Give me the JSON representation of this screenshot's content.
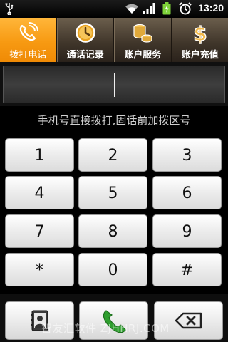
{
  "status_bar": {
    "time": "13:20",
    "icons": [
      "usb-icon",
      "wifi-icon",
      "signal-icon",
      "battery-charging-icon",
      "alarm-icon"
    ]
  },
  "tabs": [
    {
      "label": "拨打电话",
      "icon": "phone-ring-icon",
      "active": true
    },
    {
      "label": "通话记录",
      "icon": "clock-icon",
      "active": false
    },
    {
      "label": "账户服务",
      "icon": "coins-icon",
      "active": false
    },
    {
      "label": "账户充值",
      "icon": "dollar-icon",
      "active": false
    }
  ],
  "number_display": {
    "value": ""
  },
  "hint": "手机号直接拨打,固话前加拨区号",
  "keypad": {
    "keys": [
      "1",
      "2",
      "3",
      "4",
      "5",
      "6",
      "7",
      "8",
      "9",
      "*",
      "0",
      "#"
    ]
  },
  "bottom_bar": {
    "buttons": [
      "contacts-icon",
      "call-icon",
      "backspace-icon"
    ]
  },
  "watermark": "智友汇软件 ZJHHRJ.COM",
  "colors": {
    "tab_active": "#f79a12",
    "tab_bar": "#3e3429",
    "call_green": "#2e9e2e",
    "background": "#000000"
  }
}
